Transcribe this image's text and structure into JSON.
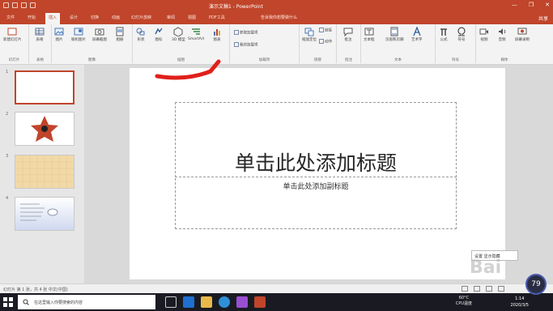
{
  "window": {
    "title": "演示文稿1 - PowerPoint",
    "controls": [
      "—",
      "❐",
      "✕"
    ]
  },
  "tabs": [
    {
      "label": "文件"
    },
    {
      "label": "开始"
    },
    {
      "label": "插入"
    },
    {
      "label": "设计"
    },
    {
      "label": "切换"
    },
    {
      "label": "动画"
    },
    {
      "label": "幻灯片放映"
    },
    {
      "label": "审阅"
    },
    {
      "label": "视图"
    },
    {
      "label": "PDF工具"
    },
    {
      "label": "告诉我你想要做什么"
    }
  ],
  "active_tab": "插入",
  "share_label": "共享",
  "ribbon": {
    "groups": [
      {
        "label": "幻灯片",
        "buttons": [
          "新建幻灯片"
        ]
      },
      {
        "label": "表格",
        "buttons": [
          "表格"
        ]
      },
      {
        "label": "图像",
        "buttons": [
          "图片",
          "联机图片",
          "屏幕截图",
          "相册"
        ]
      },
      {
        "label": "插图",
        "buttons": [
          "形状",
          "图标",
          "3D 模型",
          "SmartArt",
          "图表"
        ]
      },
      {
        "label": "加载项",
        "buttons": [
          "获取加载项",
          "我的加载项"
        ]
      },
      {
        "label": "链接",
        "buttons": [
          "缩放定位",
          "链接",
          "动作"
        ]
      },
      {
        "label": "批注",
        "buttons": [
          "批注"
        ]
      },
      {
        "label": "文本",
        "buttons": [
          "文本框",
          "页眉和页脚",
          "艺术字"
        ]
      },
      {
        "label": "符号",
        "buttons": [
          "公式",
          "符号"
        ]
      },
      {
        "label": "媒体",
        "buttons": [
          "视频",
          "音频",
          "屏幕录制"
        ]
      }
    ]
  },
  "thumbnails": [
    {
      "number": "1",
      "selected": true
    },
    {
      "number": "2",
      "selected": false
    },
    {
      "number": "3",
      "selected": false
    },
    {
      "number": "4",
      "selected": false
    }
  ],
  "slide": {
    "title_placeholder": "单击此处添加标题",
    "subtitle_placeholder": "单击此处添加副标题"
  },
  "statusbar": {
    "info": "幻灯片 第 1 张，共 4 张   中文(中国)"
  },
  "taskbar": {
    "search_placeholder": "在这里输入你要搜索的内容",
    "temperature": "60°C",
    "cpu_label": "CPU温度",
    "time": "1:14",
    "date": "2020/3/5"
  },
  "popup": {
    "text": "设置 显示隐藏"
  },
  "badge": {
    "value": "79"
  },
  "watermark": {
    "text": "Bai"
  },
  "colors": {
    "accent": "#c0452a",
    "ribbon_bg": "#f3f3f3",
    "taskbar_bg": "#1a1b22"
  }
}
